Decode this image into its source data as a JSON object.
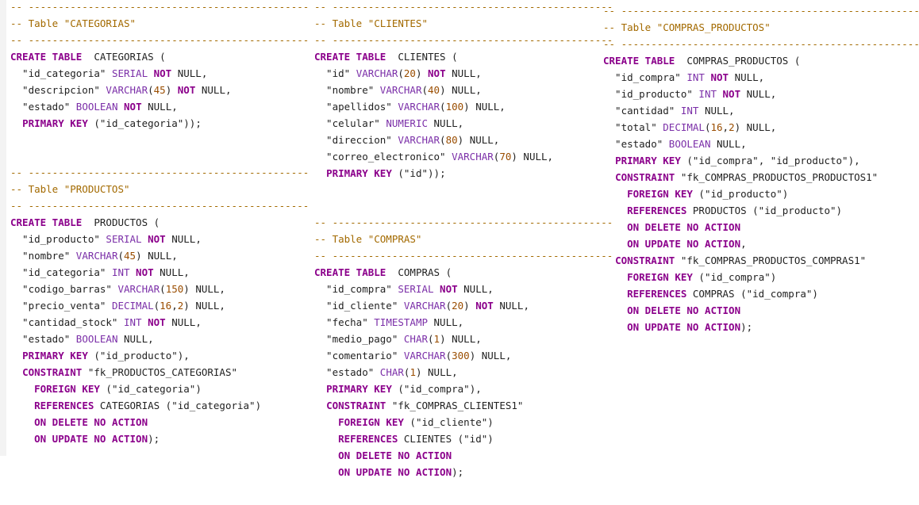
{
  "colors": {
    "background": "#ffffff",
    "comment": "#a36a00",
    "keyword": "#8b008b",
    "type": "#7b2fa8",
    "number": "#9a4d00",
    "text": "#222222"
  },
  "blocks": [
    {
      "name": "categorias-table",
      "lines": [
        [
          [
            "cm",
            "-- -----------------------------------------------"
          ]
        ],
        [
          [
            "cm",
            "-- Table \"CATEGORIAS\""
          ]
        ],
        [
          [
            "cm",
            "-- -----------------------------------------------"
          ]
        ],
        [
          [
            "kw",
            "CREATE TABLE"
          ],
          [
            "tx",
            "  CATEGORIAS ("
          ]
        ],
        [
          [
            "tx",
            "  \"id_categoria\" "
          ],
          [
            "ty",
            "SERIAL"
          ],
          [
            "tx",
            " "
          ],
          [
            "kw",
            "NOT"
          ],
          [
            "tx",
            " NULL,"
          ]
        ],
        [
          [
            "tx",
            "  \"descripcion\" "
          ],
          [
            "ty",
            "VARCHAR"
          ],
          [
            "tx",
            "("
          ],
          [
            "nu",
            "45"
          ],
          [
            "tx",
            ") "
          ],
          [
            "kw",
            "NOT"
          ],
          [
            "tx",
            " NULL,"
          ]
        ],
        [
          [
            "tx",
            "  \"estado\" "
          ],
          [
            "ty",
            "BOOLEAN"
          ],
          [
            "tx",
            " "
          ],
          [
            "kw",
            "NOT"
          ],
          [
            "tx",
            " NULL,"
          ]
        ],
        [
          [
            "tx",
            "  "
          ],
          [
            "kw",
            "PRIMARY KEY"
          ],
          [
            "tx",
            " (\"id_categoria\"));"
          ]
        ]
      ]
    },
    {
      "name": "productos-table",
      "lines": [
        [
          [
            "cm",
            "-- -----------------------------------------------"
          ]
        ],
        [
          [
            "cm",
            "-- Table \"PRODUCTOS\""
          ]
        ],
        [
          [
            "cm",
            "-- -----------------------------------------------"
          ]
        ],
        [
          [
            "kw",
            "CREATE TABLE"
          ],
          [
            "tx",
            "  PRODUCTOS ("
          ]
        ],
        [
          [
            "tx",
            "  \"id_producto\" "
          ],
          [
            "ty",
            "SERIAL"
          ],
          [
            "tx",
            " "
          ],
          [
            "kw",
            "NOT"
          ],
          [
            "tx",
            " NULL,"
          ]
        ],
        [
          [
            "tx",
            "  \"nombre\" "
          ],
          [
            "ty",
            "VARCHAR"
          ],
          [
            "tx",
            "("
          ],
          [
            "nu",
            "45"
          ],
          [
            "tx",
            ") NULL,"
          ]
        ],
        [
          [
            "tx",
            "  \"id_categoria\" "
          ],
          [
            "ty",
            "INT"
          ],
          [
            "tx",
            " "
          ],
          [
            "kw",
            "NOT"
          ],
          [
            "tx",
            " NULL,"
          ]
        ],
        [
          [
            "tx",
            "  \"codigo_barras\" "
          ],
          [
            "ty",
            "VARCHAR"
          ],
          [
            "tx",
            "("
          ],
          [
            "nu",
            "150"
          ],
          [
            "tx",
            ") NULL,"
          ]
        ],
        [
          [
            "tx",
            "  \"precio_venta\" "
          ],
          [
            "ty",
            "DECIMAL"
          ],
          [
            "tx",
            "("
          ],
          [
            "nu",
            "16"
          ],
          [
            "tx",
            ","
          ],
          [
            "nu",
            "2"
          ],
          [
            "tx",
            ") NULL,"
          ]
        ],
        [
          [
            "tx",
            "  \"cantidad_stock\" "
          ],
          [
            "ty",
            "INT"
          ],
          [
            "tx",
            " "
          ],
          [
            "kw",
            "NOT"
          ],
          [
            "tx",
            " NULL,"
          ]
        ],
        [
          [
            "tx",
            "  \"estado\" "
          ],
          [
            "ty",
            "BOOLEAN"
          ],
          [
            "tx",
            " NULL,"
          ]
        ],
        [
          [
            "tx",
            "  "
          ],
          [
            "kw",
            "PRIMARY KEY"
          ],
          [
            "tx",
            " (\"id_producto\"),"
          ]
        ],
        [
          [
            "tx",
            "  "
          ],
          [
            "kw",
            "CONSTRAINT"
          ],
          [
            "tx",
            " \"fk_PRODUCTOS_CATEGORIAS\""
          ]
        ],
        [
          [
            "tx",
            "    "
          ],
          [
            "kw",
            "FOREIGN KEY"
          ],
          [
            "tx",
            " (\"id_categoria\")"
          ]
        ],
        [
          [
            "tx",
            "    "
          ],
          [
            "kw",
            "REFERENCES"
          ],
          [
            "tx",
            " CATEGORIAS (\"id_categoria\")"
          ]
        ],
        [
          [
            "tx",
            "    "
          ],
          [
            "kw",
            "ON DELETE NO ACTION"
          ]
        ],
        [
          [
            "tx",
            "    "
          ],
          [
            "kw",
            "ON UPDATE NO ACTION"
          ],
          [
            "tx",
            ");"
          ]
        ]
      ]
    },
    {
      "name": "clientes-table",
      "lines": [
        [
          [
            "cm",
            "-- -----------------------------------------------"
          ]
        ],
        [
          [
            "cm",
            "-- Table \"CLIENTES\""
          ]
        ],
        [
          [
            "cm",
            "-- -----------------------------------------------"
          ]
        ],
        [
          [
            "kw",
            "CREATE TABLE"
          ],
          [
            "tx",
            "  CLIENTES ("
          ]
        ],
        [
          [
            "tx",
            "  \"id\" "
          ],
          [
            "ty",
            "VARCHAR"
          ],
          [
            "tx",
            "("
          ],
          [
            "nu",
            "20"
          ],
          [
            "tx",
            ") "
          ],
          [
            "kw",
            "NOT"
          ],
          [
            "tx",
            " NULL,"
          ]
        ],
        [
          [
            "tx",
            "  \"nombre\" "
          ],
          [
            "ty",
            "VARCHAR"
          ],
          [
            "tx",
            "("
          ],
          [
            "nu",
            "40"
          ],
          [
            "tx",
            ") NULL,"
          ]
        ],
        [
          [
            "tx",
            "  \"apellidos\" "
          ],
          [
            "ty",
            "VARCHAR"
          ],
          [
            "tx",
            "("
          ],
          [
            "nu",
            "100"
          ],
          [
            "tx",
            ") NULL,"
          ]
        ],
        [
          [
            "tx",
            "  \"celular\" "
          ],
          [
            "ty",
            "NUMERIC"
          ],
          [
            "tx",
            " NULL,"
          ]
        ],
        [
          [
            "tx",
            "  \"direccion\" "
          ],
          [
            "ty",
            "VARCHAR"
          ],
          [
            "tx",
            "("
          ],
          [
            "nu",
            "80"
          ],
          [
            "tx",
            ") NULL,"
          ]
        ],
        [
          [
            "tx",
            "  \"correo_electronico\" "
          ],
          [
            "ty",
            "VARCHAR"
          ],
          [
            "tx",
            "("
          ],
          [
            "nu",
            "70"
          ],
          [
            "tx",
            ") NULL,"
          ]
        ],
        [
          [
            "tx",
            "  "
          ],
          [
            "kw",
            "PRIMARY KEY"
          ],
          [
            "tx",
            " (\"id\"));"
          ]
        ]
      ]
    },
    {
      "name": "compras-table",
      "lines": [
        [
          [
            "cm",
            "-- -----------------------------------------------"
          ]
        ],
        [
          [
            "cm",
            "-- Table \"COMPRAS\""
          ]
        ],
        [
          [
            "cm",
            "-- -----------------------------------------------"
          ]
        ],
        [
          [
            "kw",
            "CREATE TABLE"
          ],
          [
            "tx",
            "  COMPRAS ("
          ]
        ],
        [
          [
            "tx",
            "  \"id_compra\" "
          ],
          [
            "ty",
            "SERIAL"
          ],
          [
            "tx",
            " "
          ],
          [
            "kw",
            "NOT"
          ],
          [
            "tx",
            " NULL,"
          ]
        ],
        [
          [
            "tx",
            "  \"id_cliente\" "
          ],
          [
            "ty",
            "VARCHAR"
          ],
          [
            "tx",
            "("
          ],
          [
            "nu",
            "20"
          ],
          [
            "tx",
            ") "
          ],
          [
            "kw",
            "NOT"
          ],
          [
            "tx",
            " NULL,"
          ]
        ],
        [
          [
            "tx",
            "  \"fecha\" "
          ],
          [
            "ty",
            "TIMESTAMP"
          ],
          [
            "tx",
            " NULL,"
          ]
        ],
        [
          [
            "tx",
            "  \"medio_pago\" "
          ],
          [
            "ty",
            "CHAR"
          ],
          [
            "tx",
            "("
          ],
          [
            "nu",
            "1"
          ],
          [
            "tx",
            ") NULL,"
          ]
        ],
        [
          [
            "tx",
            "  \"comentario\" "
          ],
          [
            "ty",
            "VARCHAR"
          ],
          [
            "tx",
            "("
          ],
          [
            "nu",
            "300"
          ],
          [
            "tx",
            ") NULL,"
          ]
        ],
        [
          [
            "tx",
            "  \"estado\" "
          ],
          [
            "ty",
            "CHAR"
          ],
          [
            "tx",
            "("
          ],
          [
            "nu",
            "1"
          ],
          [
            "tx",
            ") NULL,"
          ]
        ],
        [
          [
            "tx",
            "  "
          ],
          [
            "kw",
            "PRIMARY KEY"
          ],
          [
            "tx",
            " (\"id_compra\"),"
          ]
        ],
        [
          [
            "tx",
            "  "
          ],
          [
            "kw",
            "CONSTRAINT"
          ],
          [
            "tx",
            " \"fk_COMPRAS_CLIENTES1\""
          ]
        ],
        [
          [
            "tx",
            "    "
          ],
          [
            "kw",
            "FOREIGN KEY"
          ],
          [
            "tx",
            " (\"id_cliente\")"
          ]
        ],
        [
          [
            "tx",
            "    "
          ],
          [
            "kw",
            "REFERENCES"
          ],
          [
            "tx",
            " CLIENTES (\"id\")"
          ]
        ],
        [
          [
            "tx",
            "    "
          ],
          [
            "kw",
            "ON DELETE NO ACTION"
          ]
        ],
        [
          [
            "tx",
            "    "
          ],
          [
            "kw",
            "ON UPDATE NO ACTION"
          ],
          [
            "tx",
            ");"
          ]
        ]
      ]
    },
    {
      "name": "compras-productos-table",
      "lines": [
        [
          [
            "cm",
            "-- ------------------------------------------------------"
          ]
        ],
        [
          [
            "cm",
            "-- Table \"COMPRAS_PRODUCTOS\""
          ]
        ],
        [
          [
            "cm",
            "-- ------------------------------------------------------"
          ]
        ],
        [
          [
            "kw",
            "CREATE TABLE"
          ],
          [
            "tx",
            "  COMPRAS_PRODUCTOS ("
          ]
        ],
        [
          [
            "tx",
            "  \"id_compra\" "
          ],
          [
            "ty",
            "INT"
          ],
          [
            "tx",
            " "
          ],
          [
            "kw",
            "NOT"
          ],
          [
            "tx",
            " NULL,"
          ]
        ],
        [
          [
            "tx",
            "  \"id_producto\" "
          ],
          [
            "ty",
            "INT"
          ],
          [
            "tx",
            " "
          ],
          [
            "kw",
            "NOT"
          ],
          [
            "tx",
            " NULL,"
          ]
        ],
        [
          [
            "tx",
            "  \"cantidad\" "
          ],
          [
            "ty",
            "INT"
          ],
          [
            "tx",
            " NULL,"
          ]
        ],
        [
          [
            "tx",
            "  \"total\" "
          ],
          [
            "ty",
            "DECIMAL"
          ],
          [
            "tx",
            "("
          ],
          [
            "nu",
            "16"
          ],
          [
            "tx",
            ","
          ],
          [
            "nu",
            "2"
          ],
          [
            "tx",
            ") NULL,"
          ]
        ],
        [
          [
            "tx",
            "  \"estado\" "
          ],
          [
            "ty",
            "BOOLEAN"
          ],
          [
            "tx",
            " NULL,"
          ]
        ],
        [
          [
            "tx",
            "  "
          ],
          [
            "kw",
            "PRIMARY KEY"
          ],
          [
            "tx",
            " (\"id_compra\", \"id_producto\"),"
          ]
        ],
        [
          [
            "tx",
            "  "
          ],
          [
            "kw",
            "CONSTRAINT"
          ],
          [
            "tx",
            " \"fk_COMPRAS_PRODUCTOS_PRODUCTOS1\""
          ]
        ],
        [
          [
            "tx",
            "    "
          ],
          [
            "kw",
            "FOREIGN KEY"
          ],
          [
            "tx",
            " (\"id_producto\")"
          ]
        ],
        [
          [
            "tx",
            "    "
          ],
          [
            "kw",
            "REFERENCES"
          ],
          [
            "tx",
            " PRODUCTOS (\"id_producto\")"
          ]
        ],
        [
          [
            "tx",
            "    "
          ],
          [
            "kw",
            "ON DELETE NO ACTION"
          ]
        ],
        [
          [
            "tx",
            "    "
          ],
          [
            "kw",
            "ON UPDATE NO ACTION"
          ],
          [
            "tx",
            ","
          ]
        ],
        [
          [
            "tx",
            "  "
          ],
          [
            "kw",
            "CONSTRAINT"
          ],
          [
            "tx",
            " \"fk_COMPRAS_PRODUCTOS_COMPRAS1\""
          ]
        ],
        [
          [
            "tx",
            "    "
          ],
          [
            "kw",
            "FOREIGN KEY"
          ],
          [
            "tx",
            " (\"id_compra\")"
          ]
        ],
        [
          [
            "tx",
            "    "
          ],
          [
            "kw",
            "REFERENCES"
          ],
          [
            "tx",
            " COMPRAS (\"id_compra\")"
          ]
        ],
        [
          [
            "tx",
            "    "
          ],
          [
            "kw",
            "ON DELETE NO ACTION"
          ]
        ],
        [
          [
            "tx",
            "    "
          ],
          [
            "kw",
            "ON UPDATE NO ACTION"
          ],
          [
            "tx",
            ");"
          ]
        ]
      ]
    }
  ]
}
